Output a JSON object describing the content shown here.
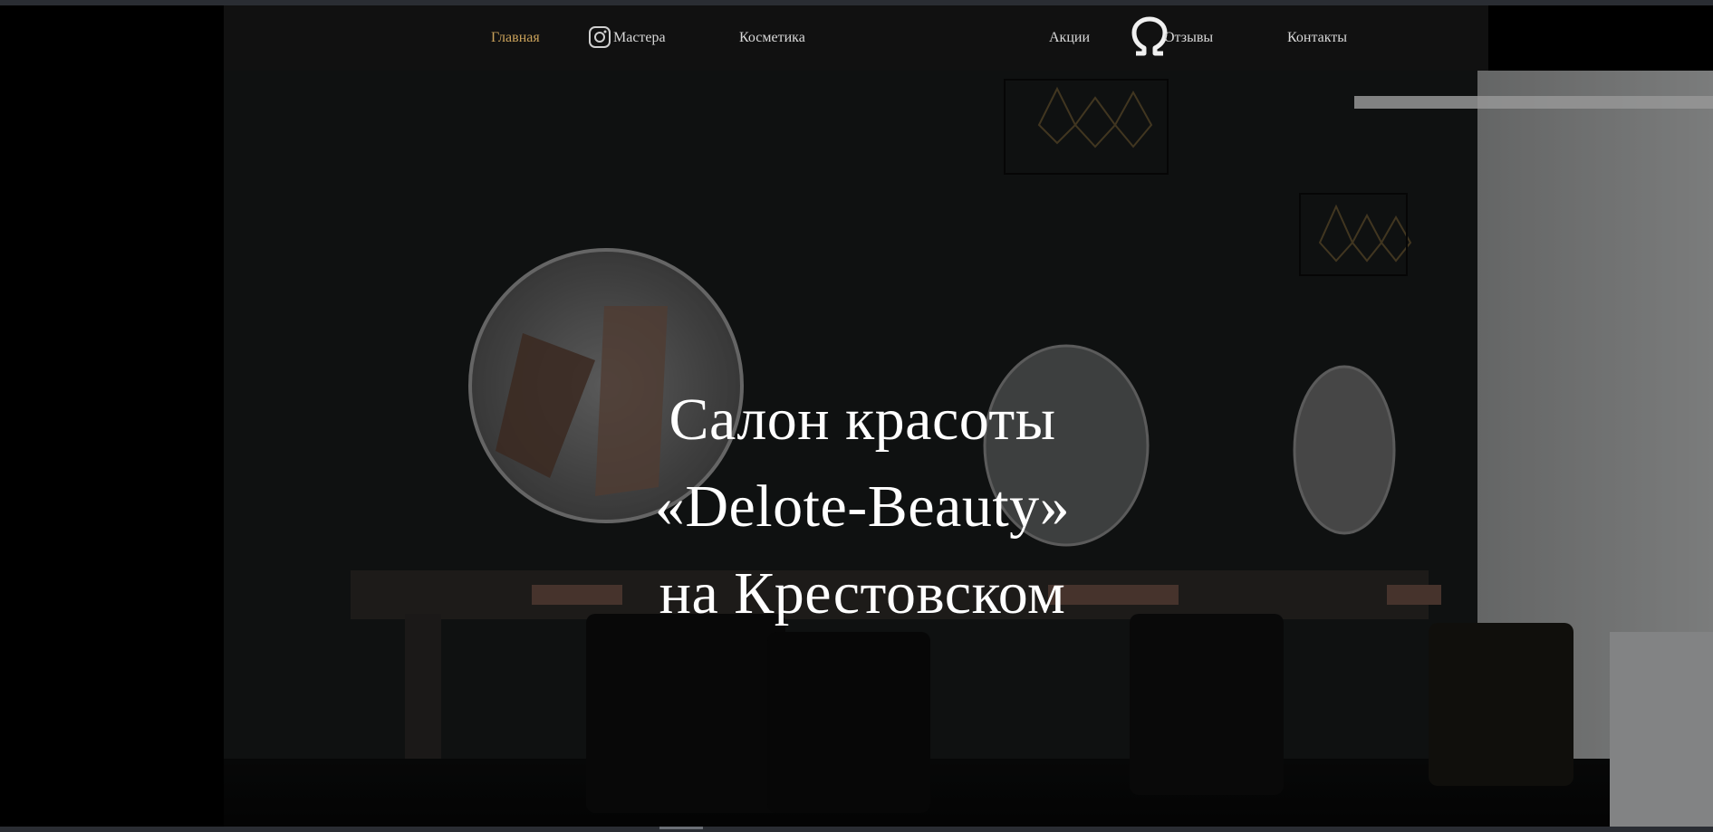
{
  "nav": {
    "items": [
      {
        "label": "Главная",
        "active": true
      },
      {
        "label": "Мастера",
        "active": false
      },
      {
        "label": "Косметика",
        "active": false
      },
      {
        "label": "Акции",
        "active": false
      },
      {
        "label": "Отзывы",
        "active": false
      },
      {
        "label": "Контакты",
        "active": false
      }
    ],
    "social_icon": "instagram-icon",
    "logo_icon": "omega-logo-icon"
  },
  "hero": {
    "title_line1": "Салон красоты",
    "title_line2": "«Delote-Beauty»",
    "title_line3": "на Крестовском"
  },
  "colors": {
    "nav_bg": "#111111",
    "active_link": "#c9a15a",
    "link": "#d9d9d9",
    "headline": "#ffffff"
  }
}
